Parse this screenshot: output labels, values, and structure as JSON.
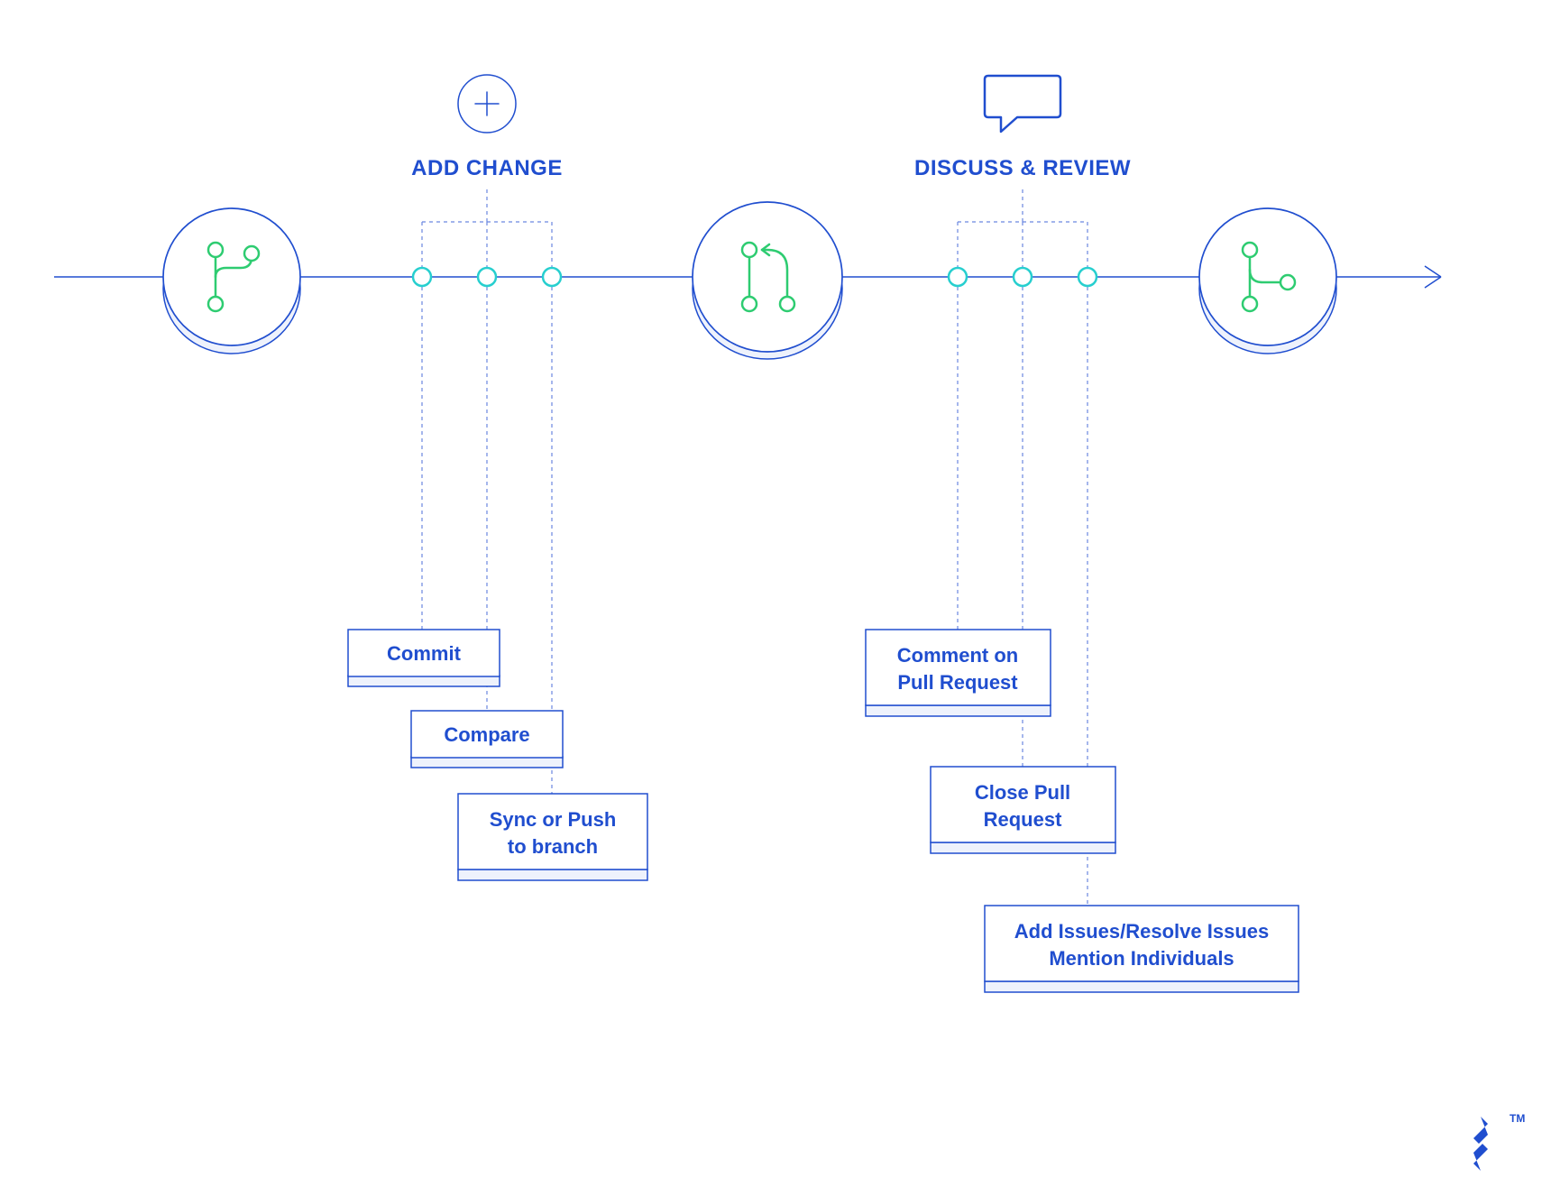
{
  "colors": {
    "primary": "#204ecf",
    "accent_green": "#2ecc71",
    "accent_teal": "#27cfcf",
    "light_fill": "#eef2fc"
  },
  "stages": {
    "add_change": {
      "title": "ADD CHANGE",
      "icon": "plus-icon",
      "actions": [
        {
          "label": "Commit"
        },
        {
          "label": "Compare"
        },
        {
          "label_line1": "Sync or Push",
          "label_line2": "to branch"
        }
      ]
    },
    "discuss_review": {
      "title": "DISCUSS & REVIEW",
      "icon": "speech-bubble-icon",
      "actions": [
        {
          "label_line1": "Comment on",
          "label_line2": "Pull Request"
        },
        {
          "label_line1": "Close Pull",
          "label_line2": "Request"
        },
        {
          "label_line1": "Add Issues/Resolve Issues",
          "label_line2": "Mention Individuals"
        }
      ]
    }
  },
  "timeline_nodes": [
    {
      "icon": "branch-icon"
    },
    {
      "icon": "pull-request-icon"
    },
    {
      "icon": "merge-icon"
    }
  ],
  "watermark": {
    "tm": "TM",
    "icon": "toptal-logo"
  }
}
